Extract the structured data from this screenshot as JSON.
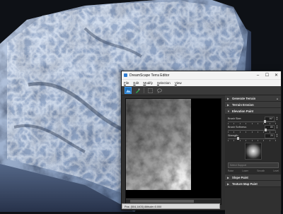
{
  "window": {
    "title": "DreamScape Terra Editor",
    "buttons": {
      "minimize": "–",
      "maximize": "☐",
      "close": "✕"
    }
  },
  "menu": [
    "File",
    "Edit",
    "Modify",
    "Selection",
    "View"
  ],
  "toolbar": {
    "tools": [
      "terrain-tool-icon",
      "brush-tool-icon",
      "select-rectangle-icon",
      "lasso-icon"
    ]
  },
  "statusbar": {
    "text": "Pos: (504,1403) Altitude=0.000"
  },
  "panel": {
    "rollouts": {
      "generate": "Generate Terrain",
      "erosion": "Terrain Erosion",
      "elevation": "Elevation Paint",
      "slope": "Slope Paint",
      "texture": "Texture Map Paint"
    },
    "elevation_params": [
      {
        "label": "Brush Size:",
        "value": "167",
        "fraction": 0.78
      },
      {
        "label": "Brush Softness:",
        "value": "80",
        "fraction": 0.8
      },
      {
        "label": "Strength:",
        "value": "20",
        "fraction": 0.2
      }
    ],
    "select_brush": "Select Support",
    "brush_tools": [
      "Raise",
      "Lower",
      "Smooth",
      "Level"
    ]
  },
  "colors": {
    "terrain_light": "#b8c8e2",
    "terrain_mid": "#7f95b6",
    "terrain_dark": "#3a4a63",
    "accent": "#1e6fb8"
  }
}
